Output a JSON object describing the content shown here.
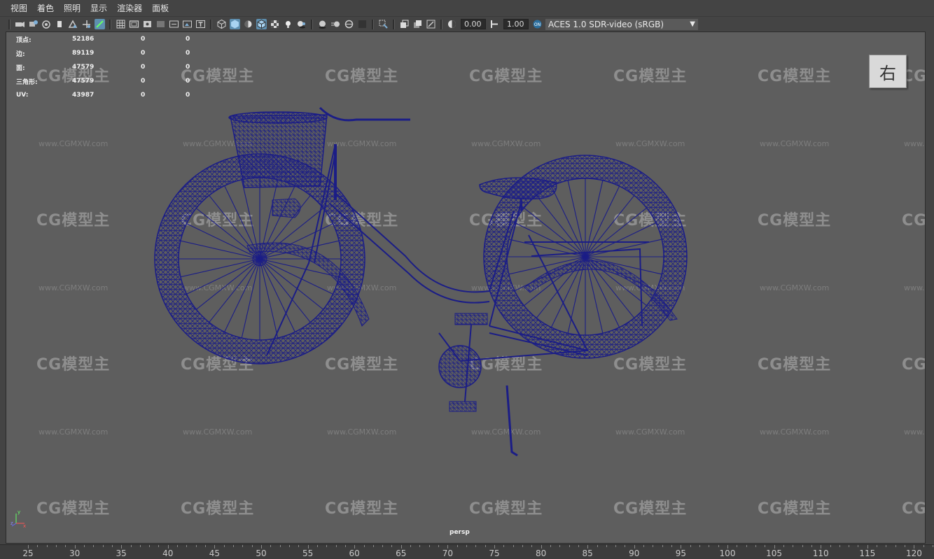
{
  "menu": [
    "视图",
    "着色",
    "照明",
    "显示",
    "渲染器",
    "面板"
  ],
  "toolbar": {
    "exposure_value": "0.00",
    "gamma_value": "1.00",
    "color_space": "ACES 1.0 SDR-video (sRGB)"
  },
  "hud": {
    "rows": [
      {
        "label": "顶点:",
        "value": "52186",
        "c1": "0",
        "c2": "0"
      },
      {
        "label": "边:",
        "value": "89119",
        "c1": "0",
        "c2": "0"
      },
      {
        "label": "面:",
        "value": "47579",
        "c1": "0",
        "c2": "0"
      },
      {
        "label": "三角形:",
        "value": "47579",
        "c1": "0",
        "c2": "0"
      },
      {
        "label": "UV:",
        "value": "43987",
        "c1": "0",
        "c2": "0"
      }
    ]
  },
  "viewcube_label": "右",
  "camera_label": "persp",
  "watermark": {
    "logo": "CG模型主",
    "url": "www.CGMXW.com"
  },
  "ruler_ticks": [
    "25",
    "30",
    "35",
    "40",
    "45",
    "50",
    "55",
    "60",
    "65",
    "70",
    "75",
    "80",
    "85",
    "90",
    "95",
    "100",
    "105",
    "110",
    "115",
    "120"
  ],
  "colors": {
    "wireframe": "#1b1d86",
    "viewport_bg": "#5e5e5e",
    "active_icon": "#5e8fb0"
  }
}
